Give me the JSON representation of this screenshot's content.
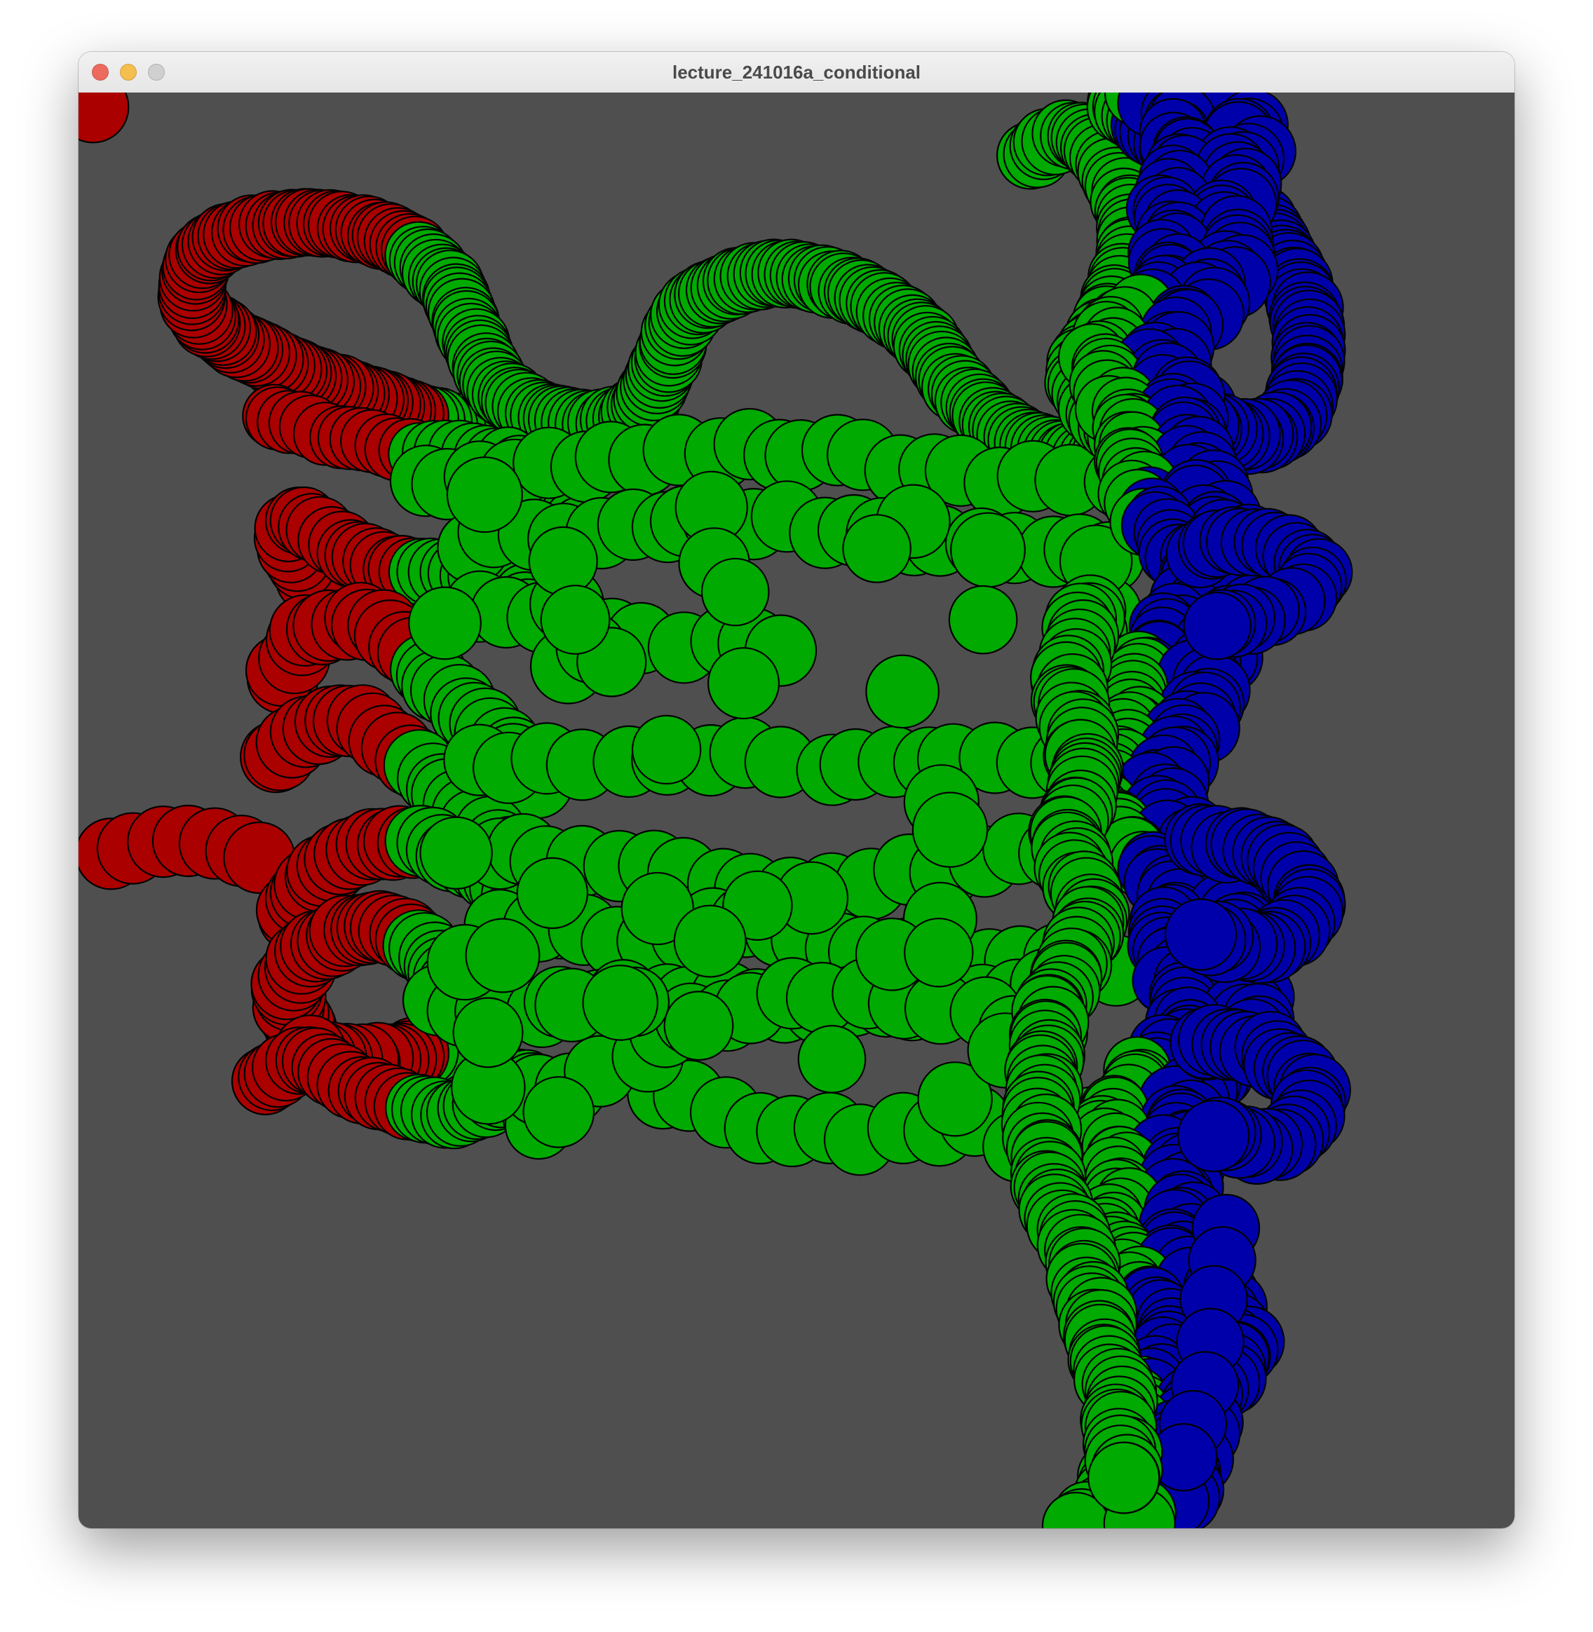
{
  "window": {
    "title": "lecture_241016a_conditional"
  },
  "colors": {
    "background": "#4f4f4f",
    "red": "#aa0000",
    "green": "#00aa00",
    "blue": "#0000aa",
    "outline": "#000000",
    "close": "#ed6a5e",
    "minimize": "#f5bf4f",
    "zoom": "#d0d0d0"
  },
  "icons": {
    "close": "close-circle-icon",
    "minimize": "minimize-circle-icon",
    "zoom": "zoom-circle-icon"
  }
}
